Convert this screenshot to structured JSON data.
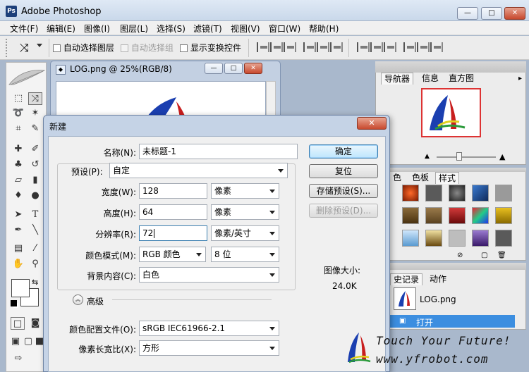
{
  "app": {
    "title": "Adobe Photoshop"
  },
  "window_controls": {
    "minimize": "—",
    "maximize": "□",
    "close": "✕"
  },
  "menu": [
    "文件(F)",
    "编辑(E)",
    "图像(I)",
    "图层(L)",
    "选择(S)",
    "滤镜(T)",
    "视图(V)",
    "窗口(W)",
    "帮助(H)"
  ],
  "options": {
    "auto_select_layer": "自动选择图层",
    "auto_select_group": "自动选择组",
    "show_transform": "显示变换控件"
  },
  "image_window": {
    "title": "LOG.png @ 25%(RGB/8)"
  },
  "navigator": {
    "tabs": [
      "导航器",
      "信息",
      "直方图"
    ]
  },
  "styles_panel": {
    "tabs": [
      "色",
      "色板",
      "样式"
    ]
  },
  "history_panel": {
    "tabs": [
      "史记录",
      "动作"
    ],
    "snapshot": "LOG.png",
    "step": "打开"
  },
  "dialog": {
    "title": "新建",
    "name_label": "名称(N):",
    "name_value": "未标题-1",
    "preset_label": "预设(P):",
    "preset_value": "自定",
    "width_label": "宽度(W):",
    "width_value": "128",
    "width_unit": "像素",
    "height_label": "高度(H):",
    "height_value": "64",
    "height_unit": "像素",
    "resolution_label": "分辨率(R):",
    "resolution_value": "72",
    "resolution_unit": "像素/英寸",
    "mode_label": "颜色模式(M):",
    "mode_value": "RGB 颜色",
    "depth_value": "8 位",
    "bg_label": "背景内容(C):",
    "bg_value": "白色",
    "advanced_label": "高级",
    "profile_label": "颜色配置文件(O):",
    "profile_value": "sRGB IEC61966-2.1",
    "aspect_label": "像素长宽比(X):",
    "aspect_value": "方形",
    "ok": "确定",
    "reset": "复位",
    "save_preset": "存储预设(S)...",
    "delete_preset": "删除预设(D)...",
    "image_size_label": "图像大小:",
    "image_size_value": "24.0K"
  },
  "watermark": {
    "line1": "Touch Your Future!",
    "line2": "www.yfrobot.com"
  }
}
